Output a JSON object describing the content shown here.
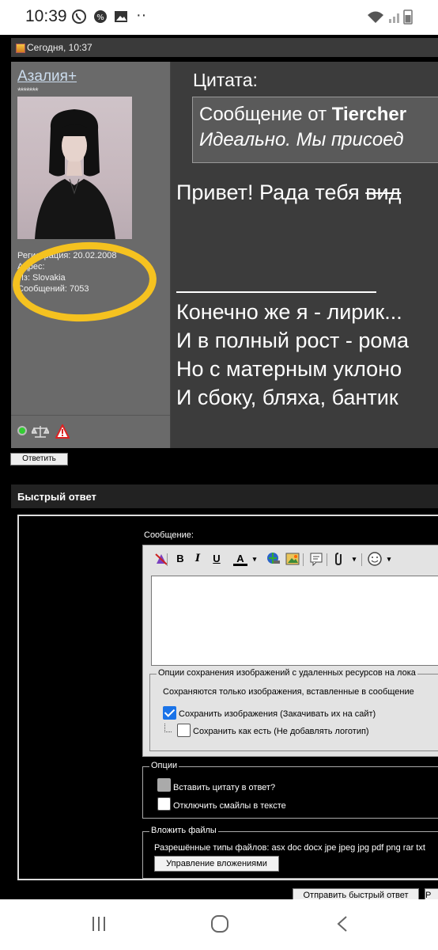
{
  "status_bar": {
    "time": "10:39"
  },
  "post": {
    "date": "Сегодня, 10:37",
    "user": {
      "name": "Азалия+",
      "stars": "*******",
      "info": [
        "Регистрация: 20.02.2008",
        "Адрес:",
        "Из: Slovakia",
        "Сообщений: 7053"
      ]
    },
    "quote_title": "Цитата:",
    "quote_author_prefix": "Сообщение от ",
    "quote_author": "Tiercher",
    "quote_text": "Идеально. Мы присоед",
    "greeting": "Привет! Рада тебя ",
    "greeting_strike": "вид",
    "poem": [
      "Конечно же я - лирик...",
      "И в полный рост - рома",
      "Но с матерным уклоно",
      "И сбоку, бляха, бантик"
    ],
    "reply_label": "Ответить"
  },
  "quick_reply": {
    "header": "Быстрый ответ",
    "message_label": "Сообщение:",
    "remote_images": {
      "legend": "Опции сохранения изображений с удаленных ресурсов на лока",
      "note": "Сохраняются только изображения, вставленные в сообщение",
      "save_images": "Сохранить изображения (Закачивать их на сайт)",
      "save_as_is": "Сохранить как есть (Не добавлять логотип)"
    },
    "options": {
      "legend": "Опции",
      "insert_quote": "Вставить цитату в ответ?",
      "disable_smilies": "Отключить смайлы в тексте"
    },
    "attachments": {
      "legend": "Вложить файлы",
      "allowed": "Разрешённые типы файлов: asx doc docx jpe jpeg jpg pdf png rar txt",
      "manage": "Управление вложениями"
    },
    "send_label": "Отправить быстрый ответ",
    "second_btn": "Р"
  },
  "colors": {
    "highlight": "#f5c220",
    "checkbox_blue": "#1a73e8"
  }
}
